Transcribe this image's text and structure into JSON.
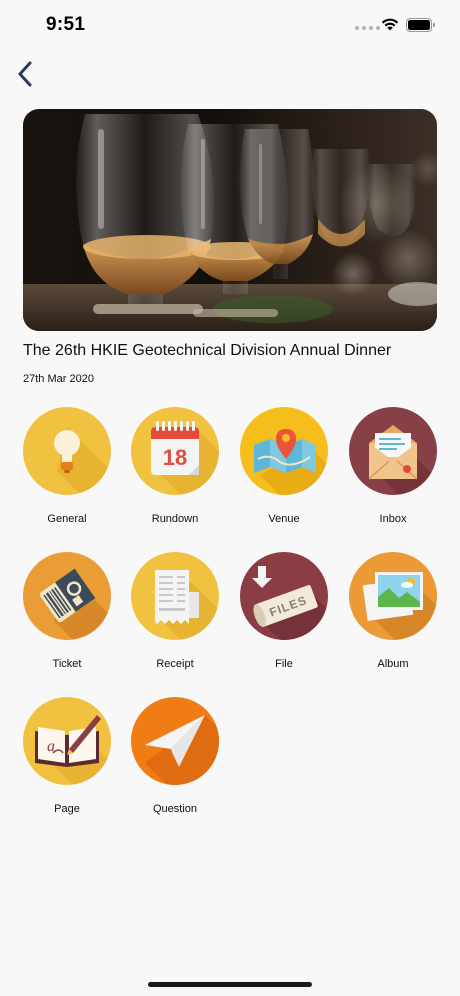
{
  "status_bar": {
    "time": "9:51"
  },
  "nav": {
    "back_icon": "chevron-left-icon"
  },
  "event": {
    "title": "The 26th HKIE Geotechnical Division Annual Dinner",
    "date": "27th Mar 2020",
    "hero_image": "whisky-glasses-photo"
  },
  "menu": [
    {
      "label": "General",
      "icon": "lightbulb-icon",
      "color": "#f1c240"
    },
    {
      "label": "Rundown",
      "icon": "calendar-icon",
      "color": "#f1c240"
    },
    {
      "label": "Venue",
      "icon": "map-pin-icon",
      "color": "#f5be1c"
    },
    {
      "label": "Inbox",
      "icon": "envelope-icon",
      "color": "#874046"
    },
    {
      "label": "Ticket",
      "icon": "ticket-icon",
      "color": "#ea9c36"
    },
    {
      "label": "Receipt",
      "icon": "receipt-icon",
      "color": "#f1c240"
    },
    {
      "label": "File",
      "icon": "files-icon",
      "color": "#8c3d44"
    },
    {
      "label": "Album",
      "icon": "photos-icon",
      "color": "#eb9a35"
    },
    {
      "label": "Page",
      "icon": "book-pen-icon",
      "color": "#f1c240"
    },
    {
      "label": "Question",
      "icon": "paper-plane-icon",
      "color": "#ef7d14"
    }
  ]
}
